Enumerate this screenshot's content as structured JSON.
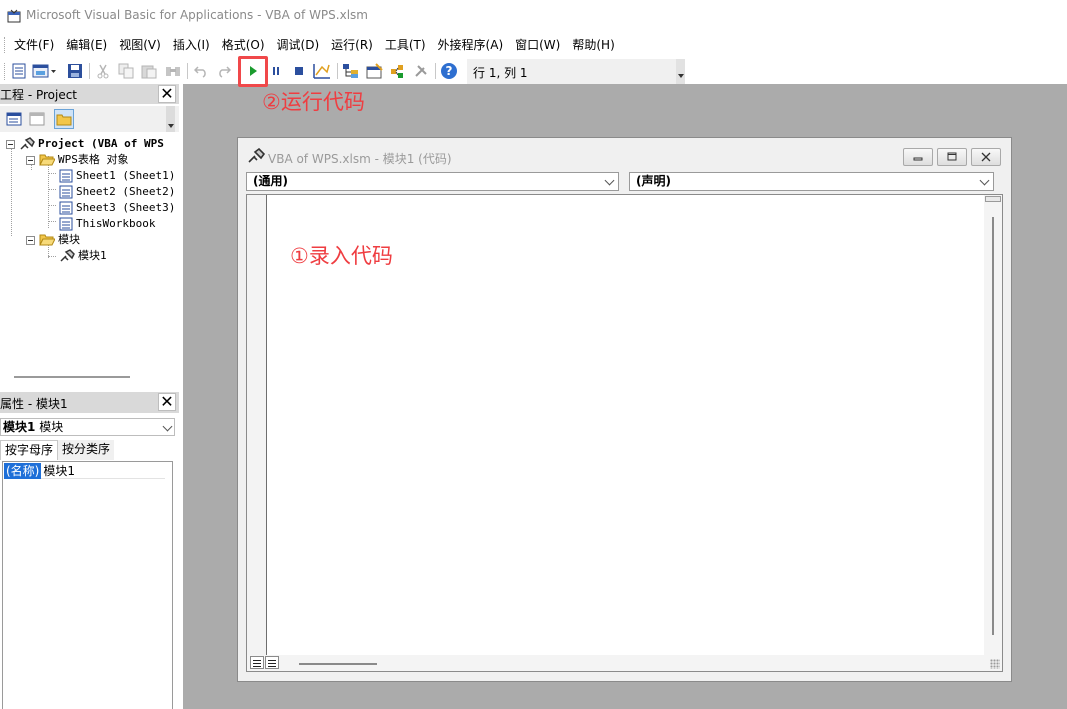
{
  "window": {
    "title": "Microsoft Visual Basic for Applications - VBA of WPS.xlsm",
    "icon": "vba-app-icon"
  },
  "menu": [
    {
      "label": "文件(F)"
    },
    {
      "label": "编辑(E)"
    },
    {
      "label": "视图(V)"
    },
    {
      "label": "插入(I)"
    },
    {
      "label": "格式(O)"
    },
    {
      "label": "调试(D)"
    },
    {
      "label": "运行(R)"
    },
    {
      "label": "工具(T)"
    },
    {
      "label": "外接程序(A)"
    },
    {
      "label": "窗口(W)"
    },
    {
      "label": "帮助(H)"
    }
  ],
  "toolbar": {
    "cursor_position": "行 1, 列 1",
    "buttons": [
      "view-excel-icon",
      "insert-module-icon",
      "save-icon",
      "cut-icon",
      "copy-icon",
      "paste-icon",
      "find-icon",
      "undo-icon",
      "redo-icon",
      "run-icon",
      "break-icon",
      "reset-icon",
      "design-mode-icon",
      "project-explorer-icon",
      "properties-icon",
      "object-browser-icon",
      "toolbox-icon",
      "help-icon"
    ]
  },
  "annotations": {
    "run_code": "②运行代码",
    "enter_code": "①录入代码",
    "highlight_color": "#f0484a",
    "text_color": "#ef3d41"
  },
  "project_pane": {
    "title": "工程 - Project",
    "tree": {
      "root": "Project (VBA of WPS",
      "objects_folder": "WPS表格 对象",
      "sheets": [
        "Sheet1 (Sheet1)",
        "Sheet2 (Sheet2)",
        "Sheet3 (Sheet3)",
        "ThisWorkbook"
      ],
      "modules_folder": "模块",
      "modules": [
        "模块1"
      ]
    }
  },
  "properties_pane": {
    "title": "属性 - 模块1",
    "object_selector": {
      "name": "模块1",
      "type": "模块"
    },
    "tabs": [
      "按字母序",
      "按分类序"
    ],
    "rows": [
      {
        "key": "(名称)",
        "value": "模块1"
      }
    ]
  },
  "code_window": {
    "title": "VBA of WPS.xlsm - 模块1 (代码)",
    "object_combo": "(通用)",
    "procedure_combo": "(声明)",
    "code": ""
  },
  "colors": {
    "workspace": "#ababab",
    "selection": "#1e6fd8",
    "run_green": "#1a9b2e"
  }
}
